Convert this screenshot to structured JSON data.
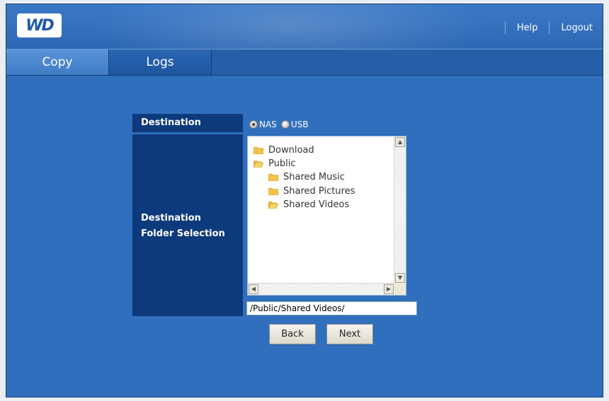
{
  "header": {
    "logo_text": "WD",
    "links": {
      "help": "Help",
      "logout": "Logout"
    }
  },
  "tabs": [
    {
      "label": "Copy",
      "active": true
    },
    {
      "label": "Logs",
      "active": false
    }
  ],
  "form": {
    "destination_label": "Destination",
    "folder_label_line1": "Destination",
    "folder_label_line2": "Folder Selection",
    "radio_options": [
      {
        "label": "NAS",
        "checked": true
      },
      {
        "label": "USB",
        "checked": false
      }
    ],
    "tree": [
      {
        "label": "Download",
        "level": 0,
        "open": false
      },
      {
        "label": "Public",
        "level": 0,
        "open": true
      },
      {
        "label": "Shared Music",
        "level": 1,
        "open": false
      },
      {
        "label": "Shared Pictures",
        "level": 1,
        "open": false
      },
      {
        "label": "Shared Videos",
        "level": 1,
        "open": true
      }
    ],
    "path_value": "/Public/Shared Videos/"
  },
  "buttons": {
    "back": "Back",
    "next": "Next"
  },
  "colors": {
    "background": "#2f6fbe",
    "label_bg": "#0d3a7c",
    "folder": "#f2c24c"
  }
}
